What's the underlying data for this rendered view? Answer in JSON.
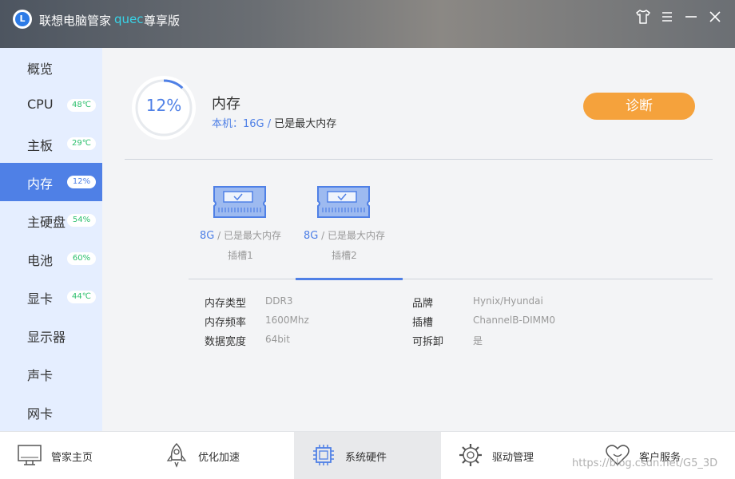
{
  "titlebar": {
    "logo_letter": "L",
    "app_name": "联想电脑管家",
    "user": "quec",
    "edition": "尊享版",
    "icons": [
      "shirt-icon",
      "menu-icon",
      "minimize-icon",
      "close-icon"
    ]
  },
  "sidebar": {
    "items": [
      {
        "label": "概览",
        "badge": null
      },
      {
        "label": "CPU",
        "badge": "48℃"
      },
      {
        "label": "主板",
        "badge": "29℃"
      },
      {
        "label": "内存",
        "badge": "12%",
        "active": true
      },
      {
        "label": "主硬盘",
        "badge": "54%"
      },
      {
        "label": "电池",
        "badge": "60%"
      },
      {
        "label": "显卡",
        "badge": "44℃"
      },
      {
        "label": "显示器",
        "badge": null
      },
      {
        "label": "声卡",
        "badge": null
      },
      {
        "label": "网卡",
        "badge": null
      }
    ]
  },
  "memory": {
    "usage_text": "12%",
    "usage_fraction": 0.12,
    "title": "内存",
    "local_label": "本机：16G",
    "separator": "/",
    "max_note": "已是最大内存",
    "diagnose_label": "诊断"
  },
  "slots": [
    {
      "size": "8G",
      "separator": "/",
      "note": "已是最大内存",
      "name": "插槽1"
    },
    {
      "size": "8G",
      "separator": "/",
      "note": "已是最大内存",
      "name": "插槽2",
      "selected": true
    }
  ],
  "specs": {
    "left": [
      {
        "label": "内存类型",
        "value": "DDR3"
      },
      {
        "label": "内存频率",
        "value": "1600Mhz"
      },
      {
        "label": "数据宽度",
        "value": "64bit"
      }
    ],
    "right": [
      {
        "label": "品牌",
        "value": "Hynix/Hyundai"
      },
      {
        "label": "插槽",
        "value": "ChannelB-DIMM0"
      },
      {
        "label": "可拆卸",
        "value": "是"
      }
    ]
  },
  "bottom_nav": [
    {
      "label": "管家主页",
      "icon": "monitor-icon"
    },
    {
      "label": "优化加速",
      "icon": "rocket-icon"
    },
    {
      "label": "系统硬件",
      "icon": "chip-icon",
      "active": true
    },
    {
      "label": "驱动管理",
      "icon": "gear-icon"
    },
    {
      "label": "客户服务",
      "icon": "heart-icon"
    }
  ],
  "watermark": "https://blog.csdn.net/G5_3D",
  "colors": {
    "accent": "#4f80e6",
    "diagnose": "#f5a23c",
    "badge_green": "#2cbf6c",
    "sidebar_bg": "#e5eeff"
  }
}
